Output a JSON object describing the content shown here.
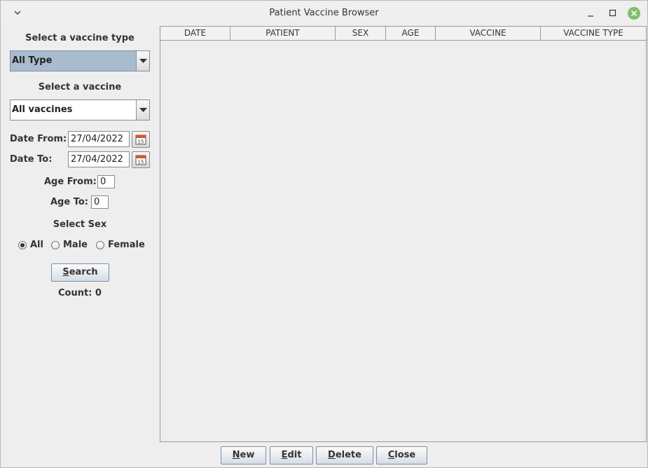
{
  "window": {
    "title": "Patient Vaccine Browser"
  },
  "filters": {
    "vaccine_type_label": "Select a vaccine type",
    "vaccine_type_value": "All Type",
    "vaccine_label": "Select a vaccine",
    "vaccine_value": "All vaccines",
    "date_from_label": "Date From:",
    "date_from_value": "27/04/2022",
    "date_to_label": "Date To:",
    "date_to_value": "27/04/2022",
    "age_from_label": "Age From:",
    "age_from_value": "0",
    "age_to_label": "Age To:",
    "age_to_value": "0",
    "sex_label": "Select Sex",
    "sex_options": [
      {
        "label": "All",
        "selected": true
      },
      {
        "label": "Male",
        "selected": false
      },
      {
        "label": "Female",
        "selected": false
      }
    ],
    "search_label_mnemonic": "S",
    "search_label_rest": "earch",
    "count_text": "Count: 0"
  },
  "table": {
    "columns": [
      "DATE",
      "PATIENT",
      "SEX",
      "AGE",
      "VACCINE",
      "VACCINE TYPE"
    ],
    "rows": []
  },
  "footer": {
    "new_m": "N",
    "new_r": "ew",
    "edit_m": "E",
    "edit_r": "dit",
    "delete_m": "D",
    "delete_r": "elete",
    "close_m": "C",
    "close_r": "lose"
  },
  "icons": {
    "menu": "chevron-down-icon",
    "minimize": "minimize-icon",
    "maximize": "maximize-icon",
    "close": "close-icon",
    "calendar": "calendar-icon"
  }
}
